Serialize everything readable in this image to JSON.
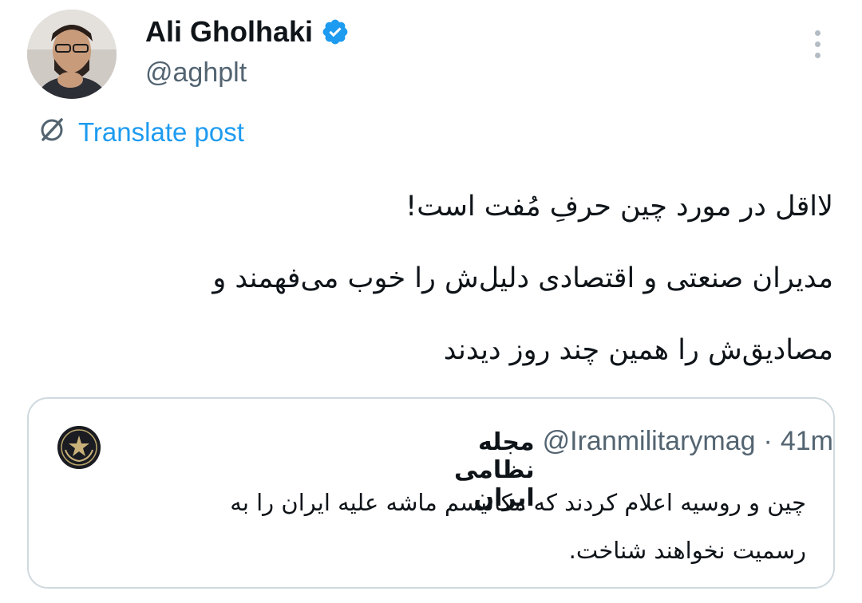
{
  "author": {
    "display_name": "Ali Gholhaki",
    "handle": "@aghplt",
    "verified_icon": "verified-badge-icon"
  },
  "menu_icon": "more-vertical-icon",
  "translate": {
    "icon": "translate-slash-icon",
    "label": "Translate post"
  },
  "post": {
    "lines": [
      "لااقل در مورد چین حرفِ مُفت است!",
      "مدیران صنعتی و اقتصادی دلیل‌ش را خوب می‌فهمند و",
      "مصادیق‌ش را همین چند روز دیدند"
    ]
  },
  "quoted_post": {
    "author_name": "مجله نظامی ایران",
    "handle": "@Iranmilitarymag",
    "separator": "·",
    "time": "41m",
    "lines": [
      "چین و روسیه اعلام کردند که مکانیسم ماشه علیه ایران را به",
      "رسمیت نخواهند شناخت."
    ]
  },
  "colors": {
    "link": "#1d9bf0",
    "secondary_text": "#536471",
    "border": "#cfd9de",
    "verified": "#1d9bf0"
  }
}
